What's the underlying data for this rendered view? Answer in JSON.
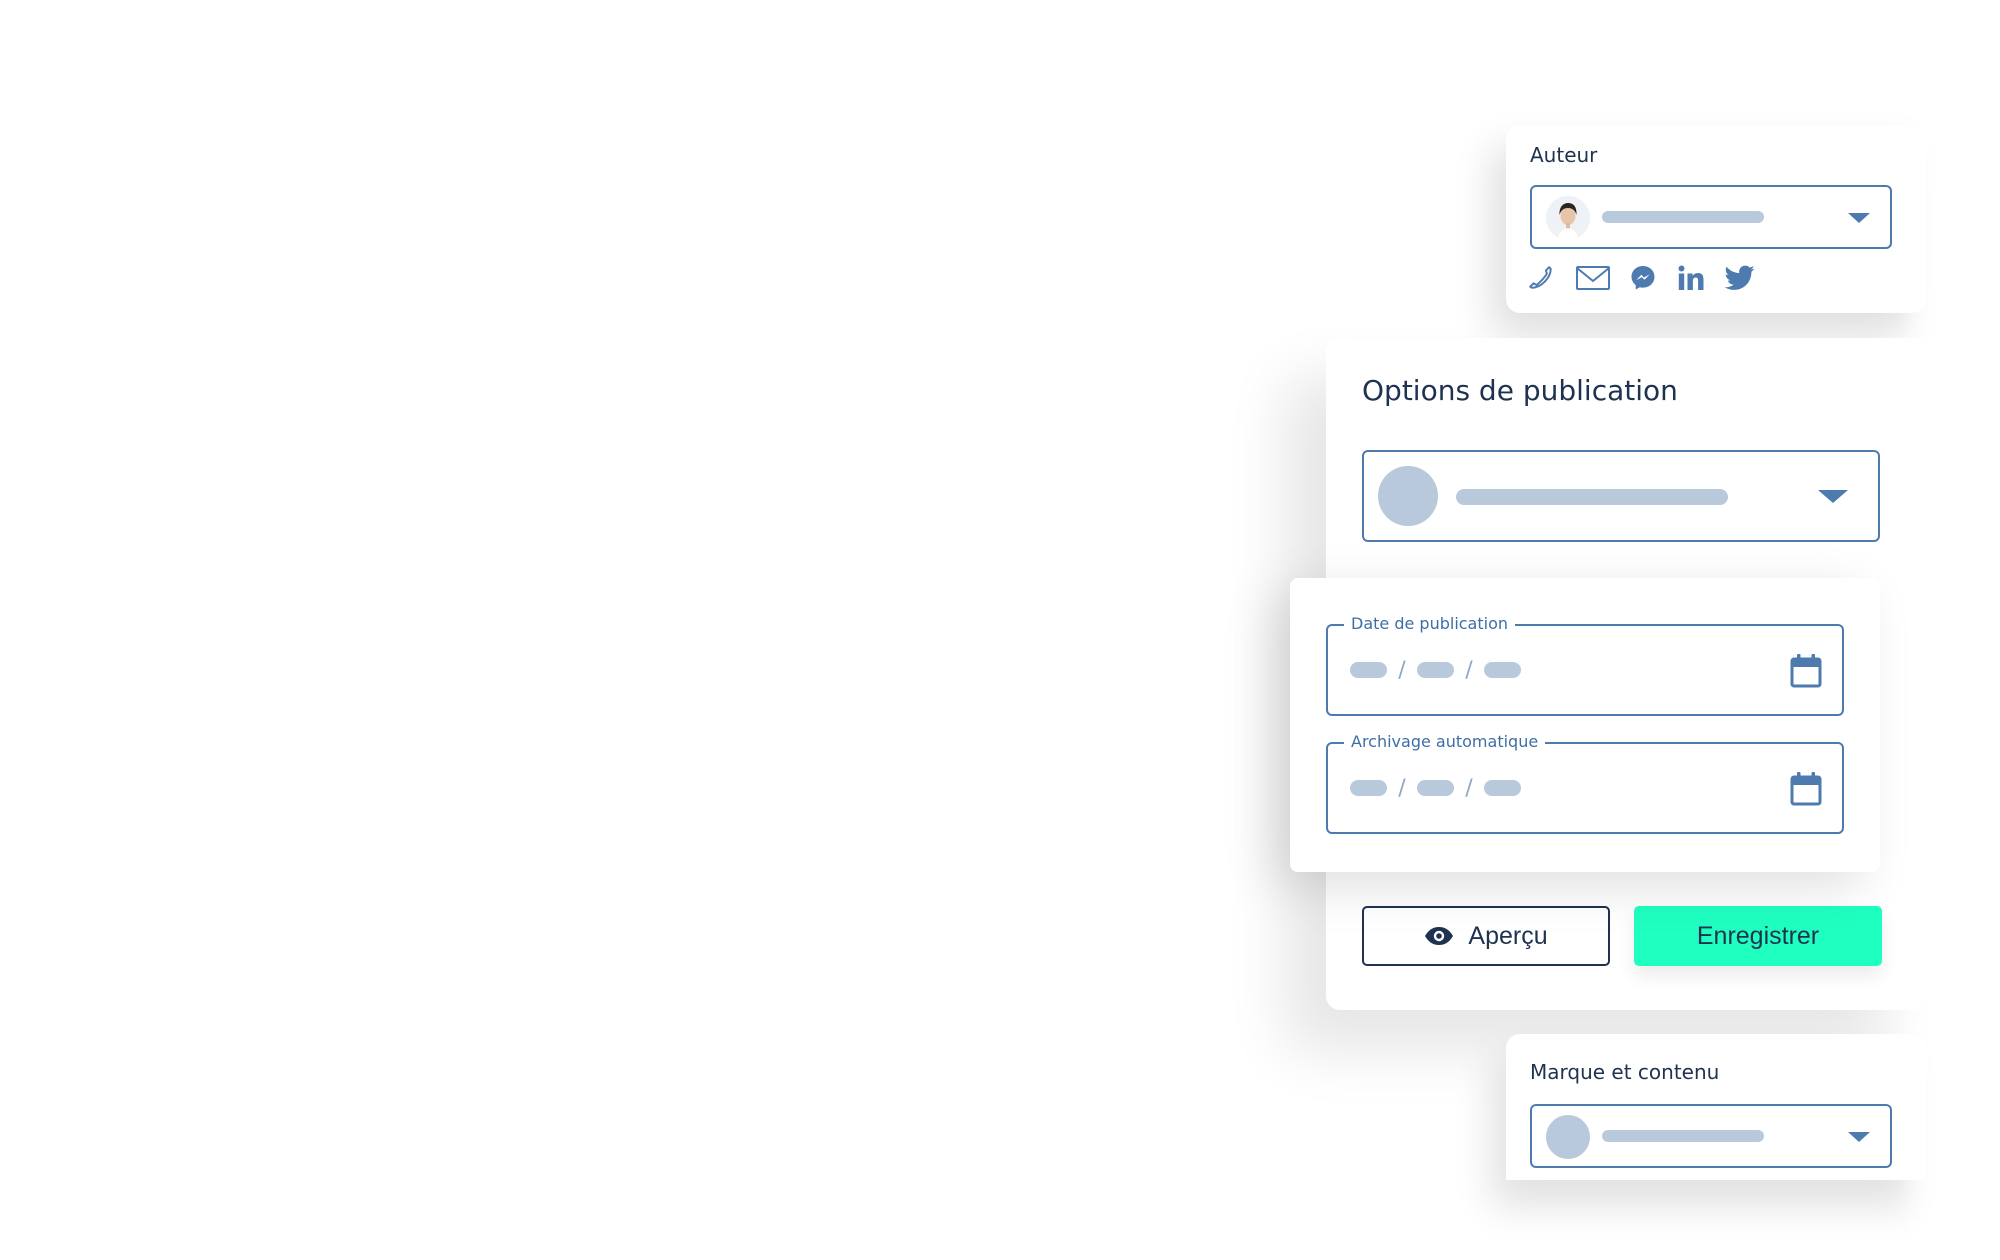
{
  "author": {
    "label": "Auteur",
    "socials": [
      "phone-icon",
      "mail-icon",
      "messenger-icon",
      "linkedin-icon",
      "twitter-icon"
    ]
  },
  "options": {
    "title": "Options de publication"
  },
  "dates": {
    "publication_label": "Date de publication",
    "archive_label": "Archivage automatique",
    "separator": "/"
  },
  "buttons": {
    "preview_label": "Aperçu",
    "save_label": "Enregistrer"
  },
  "brand": {
    "label": "Marque et contenu"
  },
  "colors": {
    "accent": "#4d7bb0",
    "primary_button": "#1fffc0",
    "text": "#1f3350",
    "skeleton": "#b9c9dc"
  }
}
